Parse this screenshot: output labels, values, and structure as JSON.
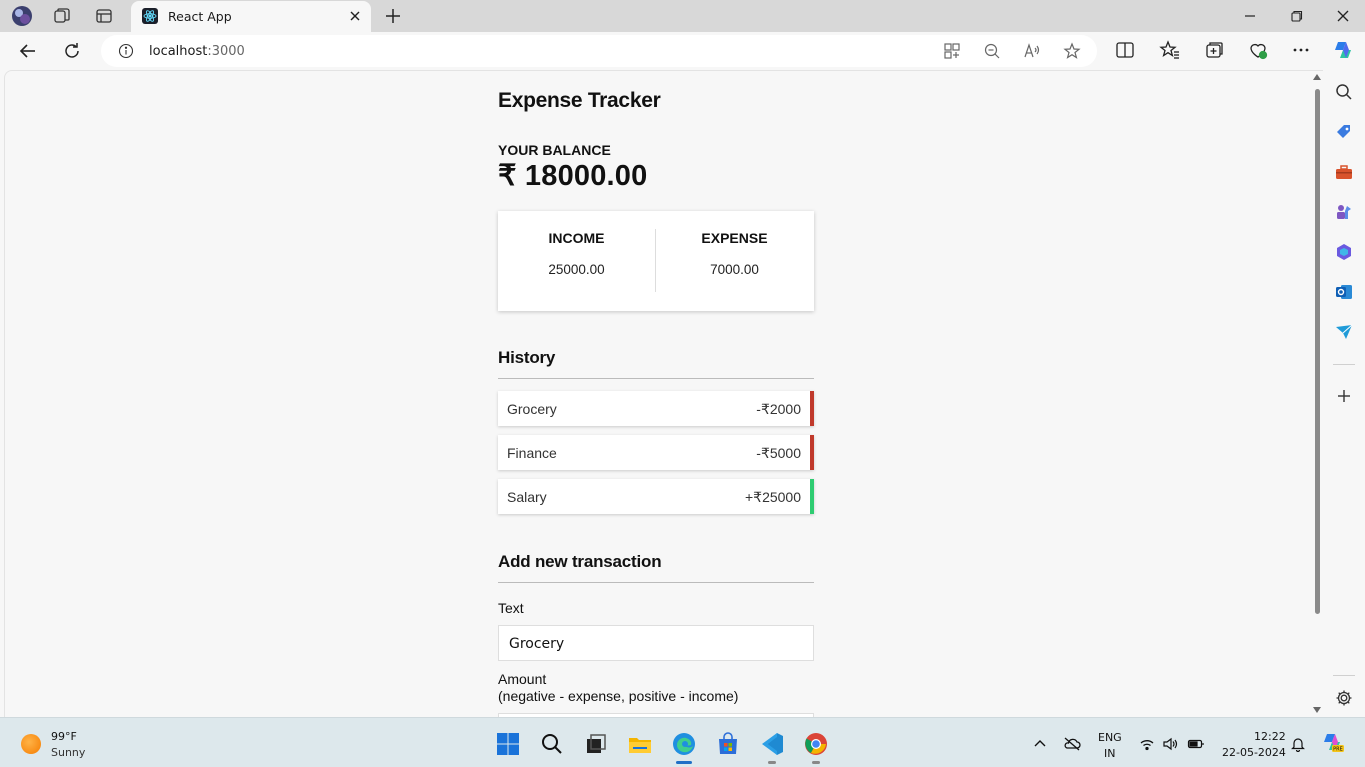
{
  "browser": {
    "tab_title": "React App",
    "url_host": "localhost",
    "url_port": ":3000"
  },
  "app": {
    "title": "Expense Tracker",
    "balance_label": "YOUR BALANCE",
    "balance_value": "₹ 18000.00",
    "income_label": "INCOME",
    "income_value": "25000.00",
    "expense_label": "EXPENSE",
    "expense_value": "7000.00",
    "history_heading": "History",
    "history": [
      {
        "text": "Grocery",
        "amount": "-₹2000",
        "type": "expense"
      },
      {
        "text": "Finance",
        "amount": "-₹5000",
        "type": "expense"
      },
      {
        "text": "Salary",
        "amount": "+₹25000",
        "type": "income"
      }
    ],
    "add_heading": "Add new transaction",
    "text_label": "Text",
    "text_value": "Grocery",
    "amount_label": "Amount",
    "amount_hint": "(negative - expense, positive - income)"
  },
  "colors": {
    "expense": "#c0392b",
    "income": "#2ecc71"
  },
  "taskbar": {
    "temperature": "99°F",
    "weather": "Sunny",
    "lang_line1": "ENG",
    "lang_line2": "IN",
    "time": "12:22",
    "date": "22-05-2024"
  }
}
